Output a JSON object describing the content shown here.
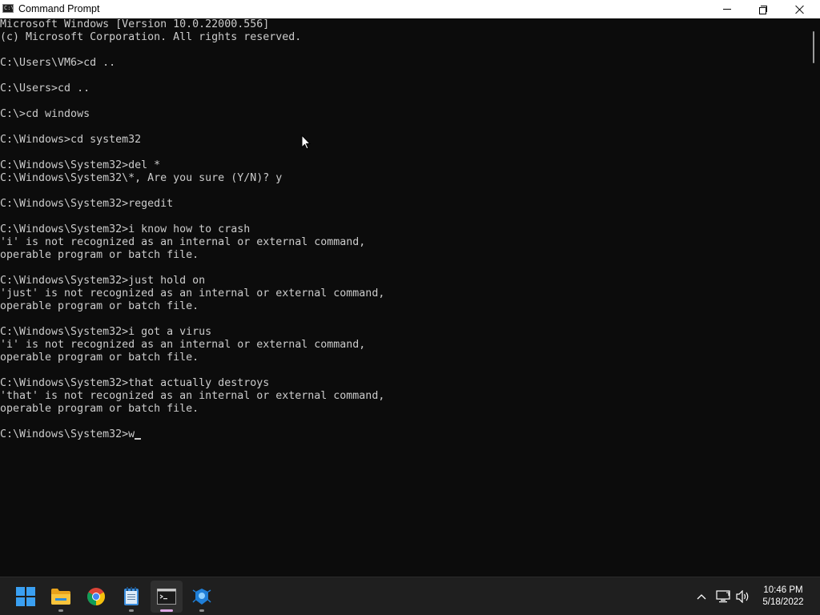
{
  "window": {
    "title": "Command Prompt",
    "app_icon_text": "C:\\",
    "controls": {
      "minimize_icon": "minimize-icon",
      "maximize_icon": "restore-icon",
      "close_icon": "close-icon"
    }
  },
  "console": {
    "text_color": "#cccccc",
    "background_color": "#0c0c0c",
    "lines": [
      "Microsoft Windows [Version 10.0.22000.556]",
      "(c) Microsoft Corporation. All rights reserved.",
      "",
      "C:\\Users\\VM6>cd ..",
      "",
      "C:\\Users>cd ..",
      "",
      "C:\\>cd windows",
      "",
      "C:\\Windows>cd system32",
      "",
      "C:\\Windows\\System32>del *",
      "C:\\Windows\\System32\\*, Are you sure (Y/N)? y",
      "",
      "C:\\Windows\\System32>regedit",
      "",
      "C:\\Windows\\System32>i know how to crash",
      "'i' is not recognized as an internal or external command,",
      "operable program or batch file.",
      "",
      "C:\\Windows\\System32>just hold on",
      "'just' is not recognized as an internal or external command,",
      "operable program or batch file.",
      "",
      "C:\\Windows\\System32>i got a virus",
      "'i' is not recognized as an internal or external command,",
      "operable program or batch file.",
      "",
      "C:\\Windows\\System32>that actually destroys",
      "'that' is not recognized as an internal or external command,",
      "operable program or batch file.",
      ""
    ],
    "prompt": "C:\\Windows\\System32>",
    "current_input": "w"
  },
  "taskbar": {
    "apps": [
      {
        "name": "start-button",
        "icon": "windows-logo-icon",
        "running": false,
        "active": false
      },
      {
        "name": "file-explorer",
        "icon": "folder-icon",
        "running": true,
        "active": false
      },
      {
        "name": "chrome",
        "icon": "chrome-icon",
        "running": false,
        "active": false
      },
      {
        "name": "notepad",
        "icon": "notepad-icon",
        "running": true,
        "active": false
      },
      {
        "name": "command-prompt",
        "icon": "terminal-icon",
        "running": true,
        "active": true
      },
      {
        "name": "blue-app",
        "icon": "bug-icon",
        "running": true,
        "active": false
      }
    ],
    "tray": {
      "icons": [
        "chevron-up-icon",
        "network-icon",
        "volume-icon"
      ]
    },
    "clock": {
      "time": "10:46 PM",
      "date": "5/18/2022"
    }
  }
}
